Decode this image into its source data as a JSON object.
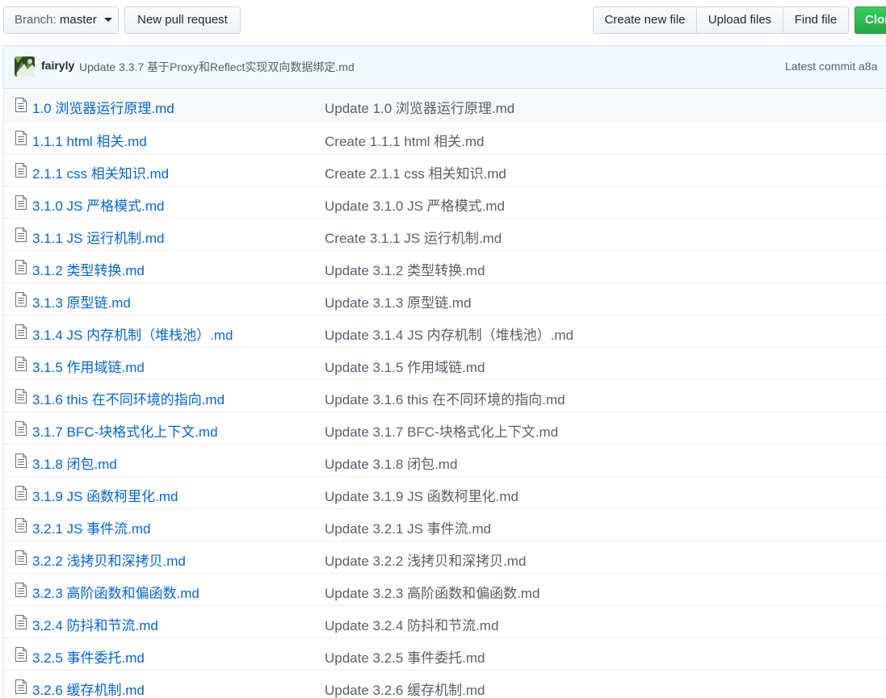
{
  "toolbar": {
    "branch_prefix": "Branch:",
    "branch_name": "master",
    "new_pull_request": "New pull request",
    "create_new_file": "Create new file",
    "upload_files": "Upload files",
    "find_file": "Find file",
    "clone": "Clone or download"
  },
  "commit": {
    "author": "fairyly",
    "message": "Update 3.3.7 基于Proxy和Reflect实现双向数据绑定.md",
    "latest_label": "Latest commit",
    "sha": "a8a"
  },
  "colors": {
    "link": "#0366d6",
    "muted": "#586069",
    "commit_bar_bg": "#f1f8ff",
    "clone_green": "#28a745"
  },
  "files": [
    {
      "icon": "file-icon",
      "name": "1.0 浏览器运行原理.md",
      "message": "Update 1.0 浏览器运行原理.md"
    },
    {
      "icon": "file-icon",
      "name": "1.1.1 html 相关.md",
      "message": "Create 1.1.1 html 相关.md"
    },
    {
      "icon": "file-icon",
      "name": "2.1.1 css 相关知识.md",
      "message": "Create 2.1.1 css 相关知识.md"
    },
    {
      "icon": "file-icon",
      "name": "3.1.0 JS 严格模式.md",
      "message": "Update 3.1.0 JS 严格模式.md"
    },
    {
      "icon": "file-icon",
      "name": "3.1.1 JS 运行机制.md",
      "message": "Create 3.1.1 JS 运行机制.md"
    },
    {
      "icon": "file-icon",
      "name": "3.1.2 类型转换.md",
      "message": "Update 3.1.2 类型转换.md"
    },
    {
      "icon": "file-icon",
      "name": "3.1.3 原型链.md",
      "message": "Update 3.1.3 原型链.md"
    },
    {
      "icon": "file-icon",
      "name": "3.1.4 JS 内存机制（堆栈池）.md",
      "message": "Update 3.1.4 JS 内存机制（堆栈池）.md"
    },
    {
      "icon": "file-icon",
      "name": "3.1.5 作用域链.md",
      "message": "Update 3.1.5 作用域链.md"
    },
    {
      "icon": "file-icon",
      "name": "3.1.6 this 在不同环境的指向.md",
      "message": "Update 3.1.6 this 在不同环境的指向.md"
    },
    {
      "icon": "file-icon",
      "name": "3.1.7 BFC-块格式化上下文.md",
      "message": "Update 3.1.7 BFC-块格式化上下文.md"
    },
    {
      "icon": "file-icon",
      "name": "3.1.8 闭包.md",
      "message": "Update 3.1.8 闭包.md"
    },
    {
      "icon": "file-icon",
      "name": "3.1.9 JS 函数柯里化.md",
      "message": "Update 3.1.9 JS 函数柯里化.md"
    },
    {
      "icon": "file-icon",
      "name": "3.2.1 JS 事件流.md",
      "message": "Update 3.2.1 JS 事件流.md"
    },
    {
      "icon": "file-icon",
      "name": "3.2.2 浅拷贝和深拷贝.md",
      "message": "Update 3.2.2 浅拷贝和深拷贝.md"
    },
    {
      "icon": "file-icon",
      "name": "3.2.3 高阶函数和偏函数.md",
      "message": "Update 3.2.3 高阶函数和偏函数.md"
    },
    {
      "icon": "file-icon",
      "name": "3.2.4 防抖和节流.md",
      "message": "Update 3.2.4 防抖和节流.md"
    },
    {
      "icon": "file-icon",
      "name": "3.2.5 事件委托.md",
      "message": "Update 3.2.5 事件委托.md"
    },
    {
      "icon": "file-icon",
      "name": "3.2.6 缓存机制.md",
      "message": "Update 3.2.6 缓存机制.md"
    }
  ]
}
